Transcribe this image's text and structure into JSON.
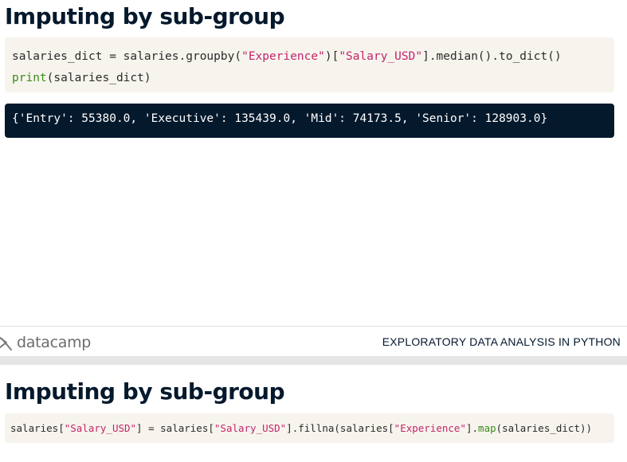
{
  "slides": [
    {
      "title": "Imputing by sub-group",
      "code": {
        "line1": {
          "p1": "salaries_dict = salaries.groupby(",
          "s1": "\"Experience\"",
          "p2": ")[",
          "s2": "\"Salary_USD\"",
          "p3": "].median().to_dict()"
        },
        "line2": {
          "fn": "print",
          "p1": "(salaries_dict)"
        }
      },
      "output": "{'Entry': 55380.0, 'Executive': 135439.0, 'Mid': 74173.5, 'Senior': 128903.0}"
    },
    {
      "title": "Imputing by sub-group",
      "code": {
        "line1": {
          "p1": "salaries[",
          "s1": "\"Salary_USD\"",
          "p2": "] = salaries[",
          "s2": "\"Salary_USD\"",
          "p3": "].fillna(salaries[",
          "s3": "\"Experience\"",
          "p4": "].",
          "fn": "map",
          "p5": "(salaries_dict))"
        }
      }
    }
  ],
  "footer": {
    "logo_text": "datacamp",
    "logo_icon": "datacamp-logo-icon",
    "course_title": "EXPLORATORY DATA ANALYSIS IN PYTHON"
  },
  "colors": {
    "title": "#05192d",
    "code_bg": "#f7f4ee",
    "output_bg": "#05192d",
    "string": "#c2256b",
    "function": "#3a8a16",
    "separator": "#e5e5e5"
  }
}
